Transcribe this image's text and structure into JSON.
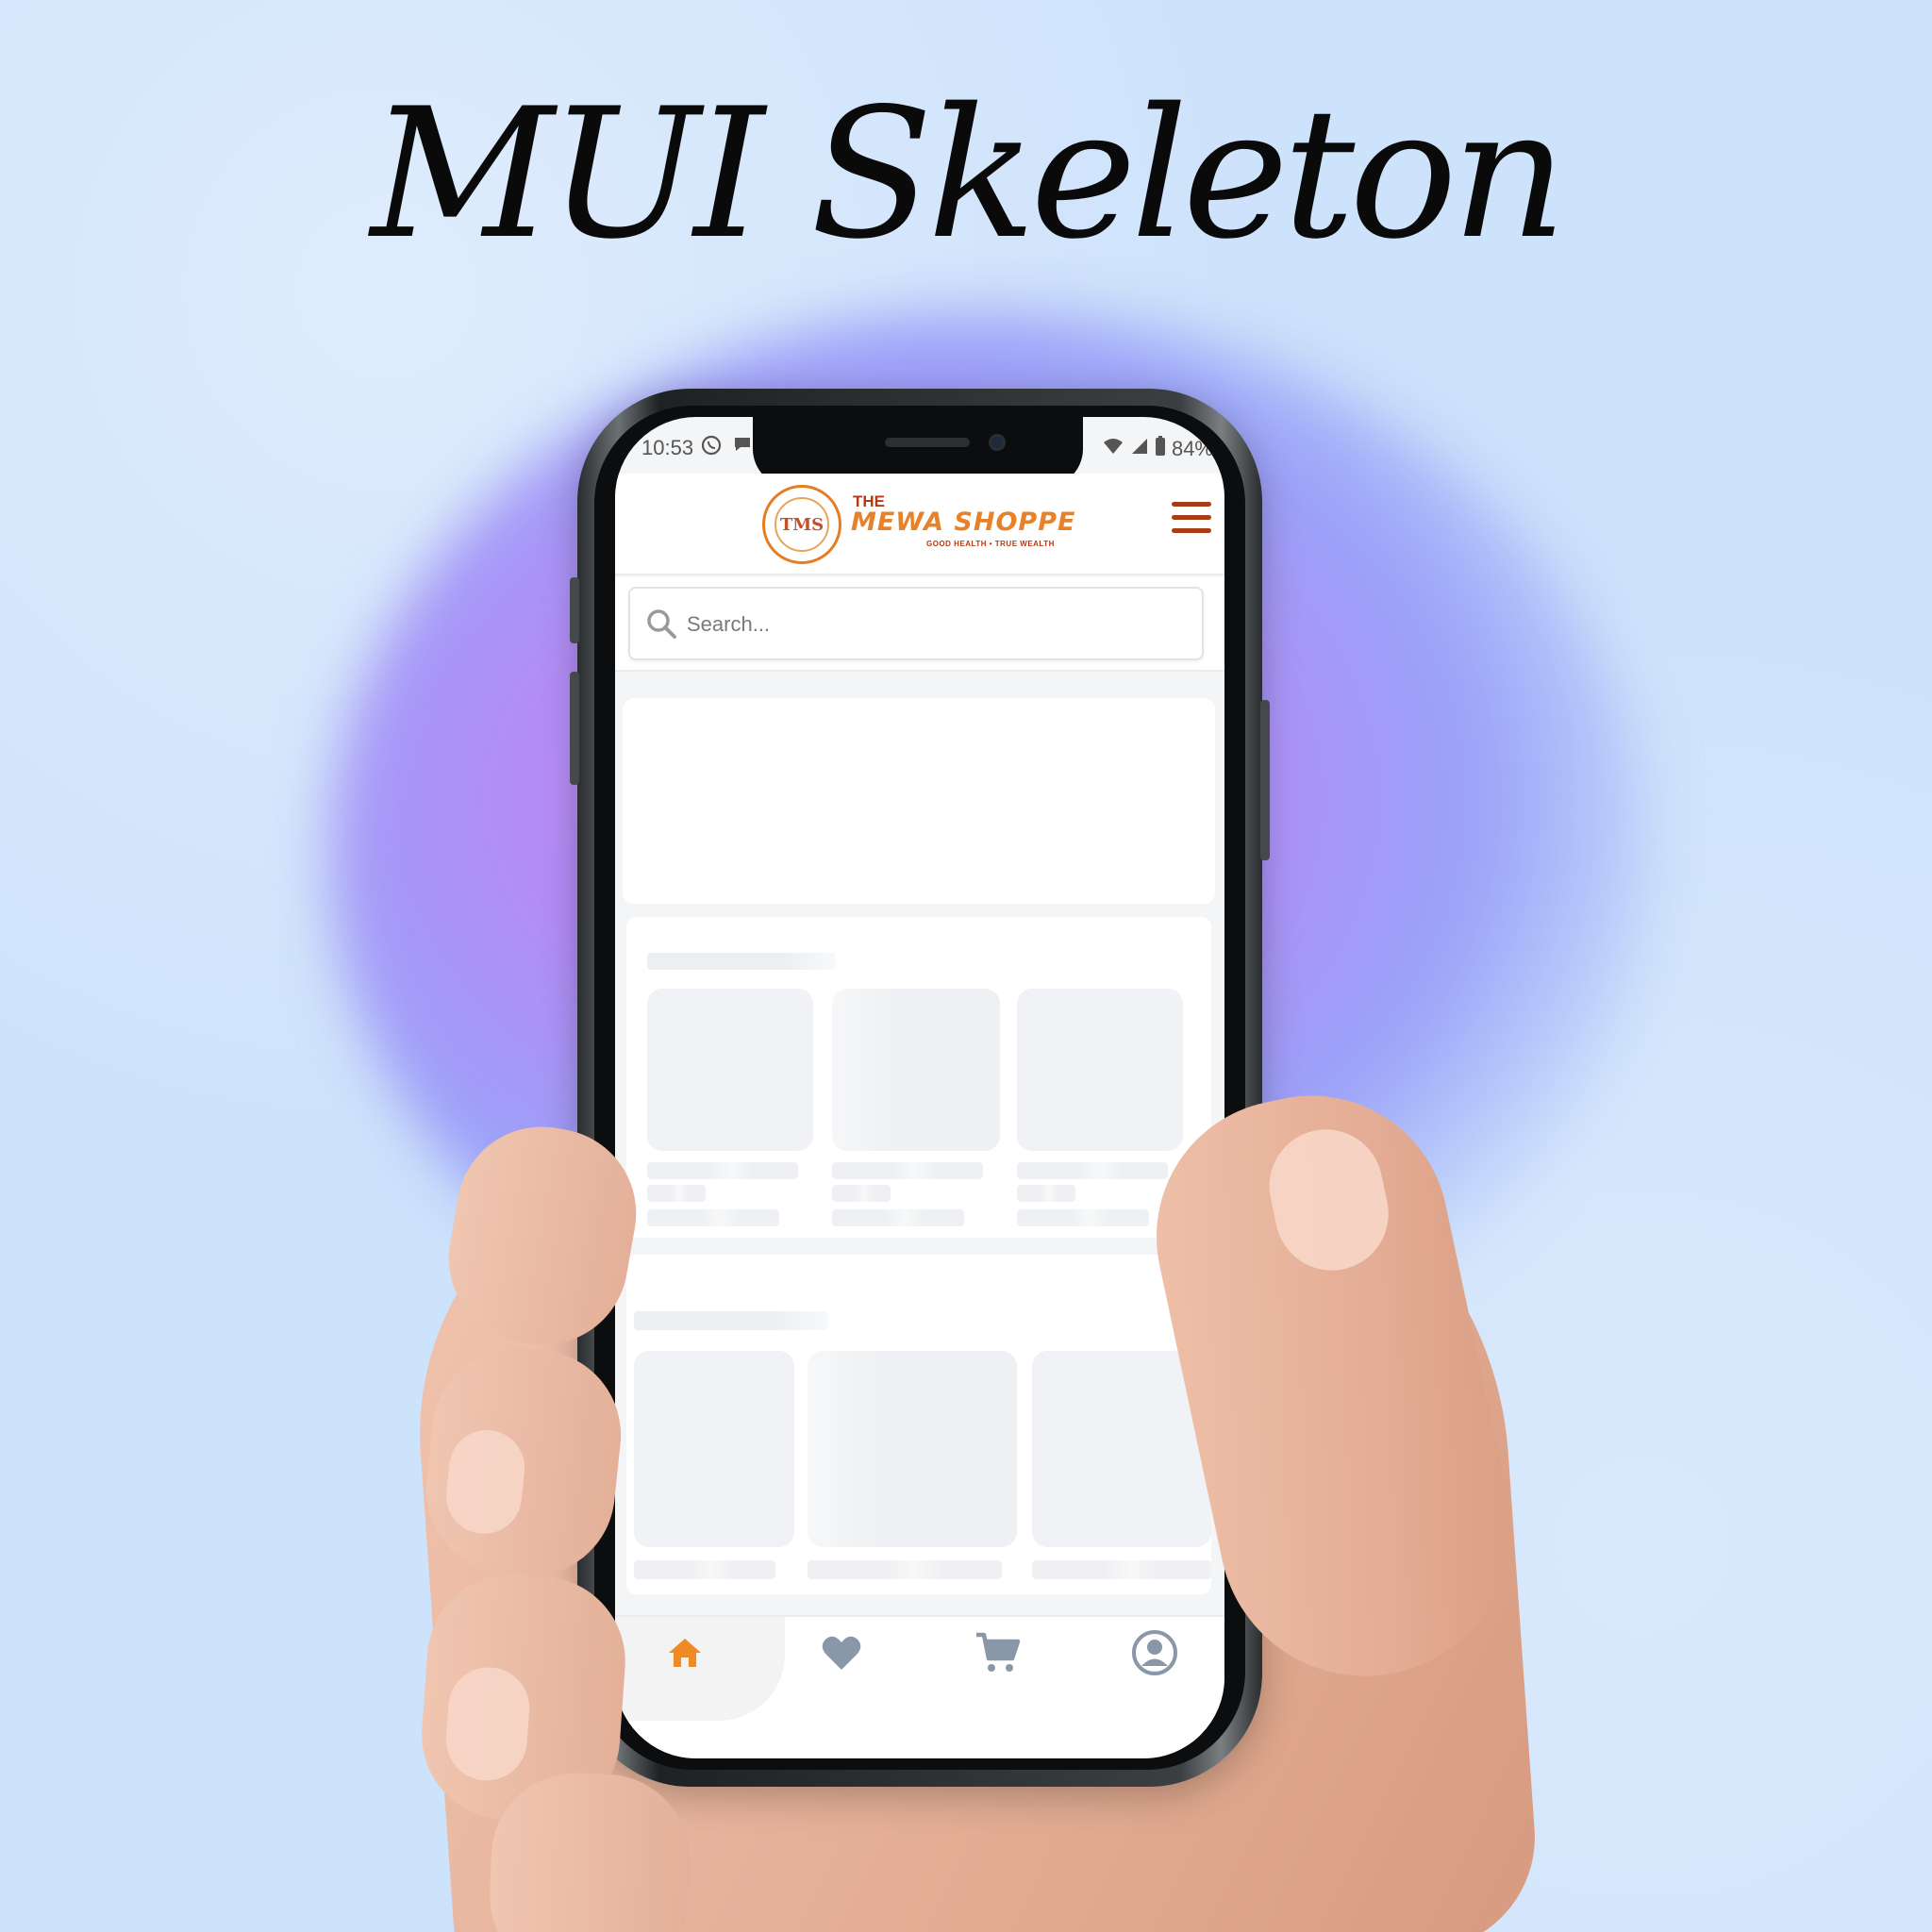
{
  "headline": "MUI Skeleton",
  "status_bar": {
    "time": "10:53",
    "battery": "84%"
  },
  "app": {
    "brand_the": "THE",
    "brand_name": "MEWA SHOPPE",
    "brand_tagline": "GOOD HEALTH • TRUE WEALTH",
    "logo_monogram": "TMS",
    "search": {
      "placeholder": "Search..."
    },
    "bottom_nav": [
      {
        "id": "home",
        "icon": "home-icon",
        "active": true
      },
      {
        "id": "wishlist",
        "icon": "heart-icon",
        "active": false
      },
      {
        "id": "cart",
        "icon": "cart-icon",
        "active": false
      },
      {
        "id": "account",
        "icon": "user-circle-icon",
        "active": false
      }
    ]
  },
  "colors": {
    "accent_orange": "#e8822a",
    "brand_dark": "#a83d14",
    "nav_inactive": "#8a97a8",
    "skeleton": "#eef0f3"
  }
}
